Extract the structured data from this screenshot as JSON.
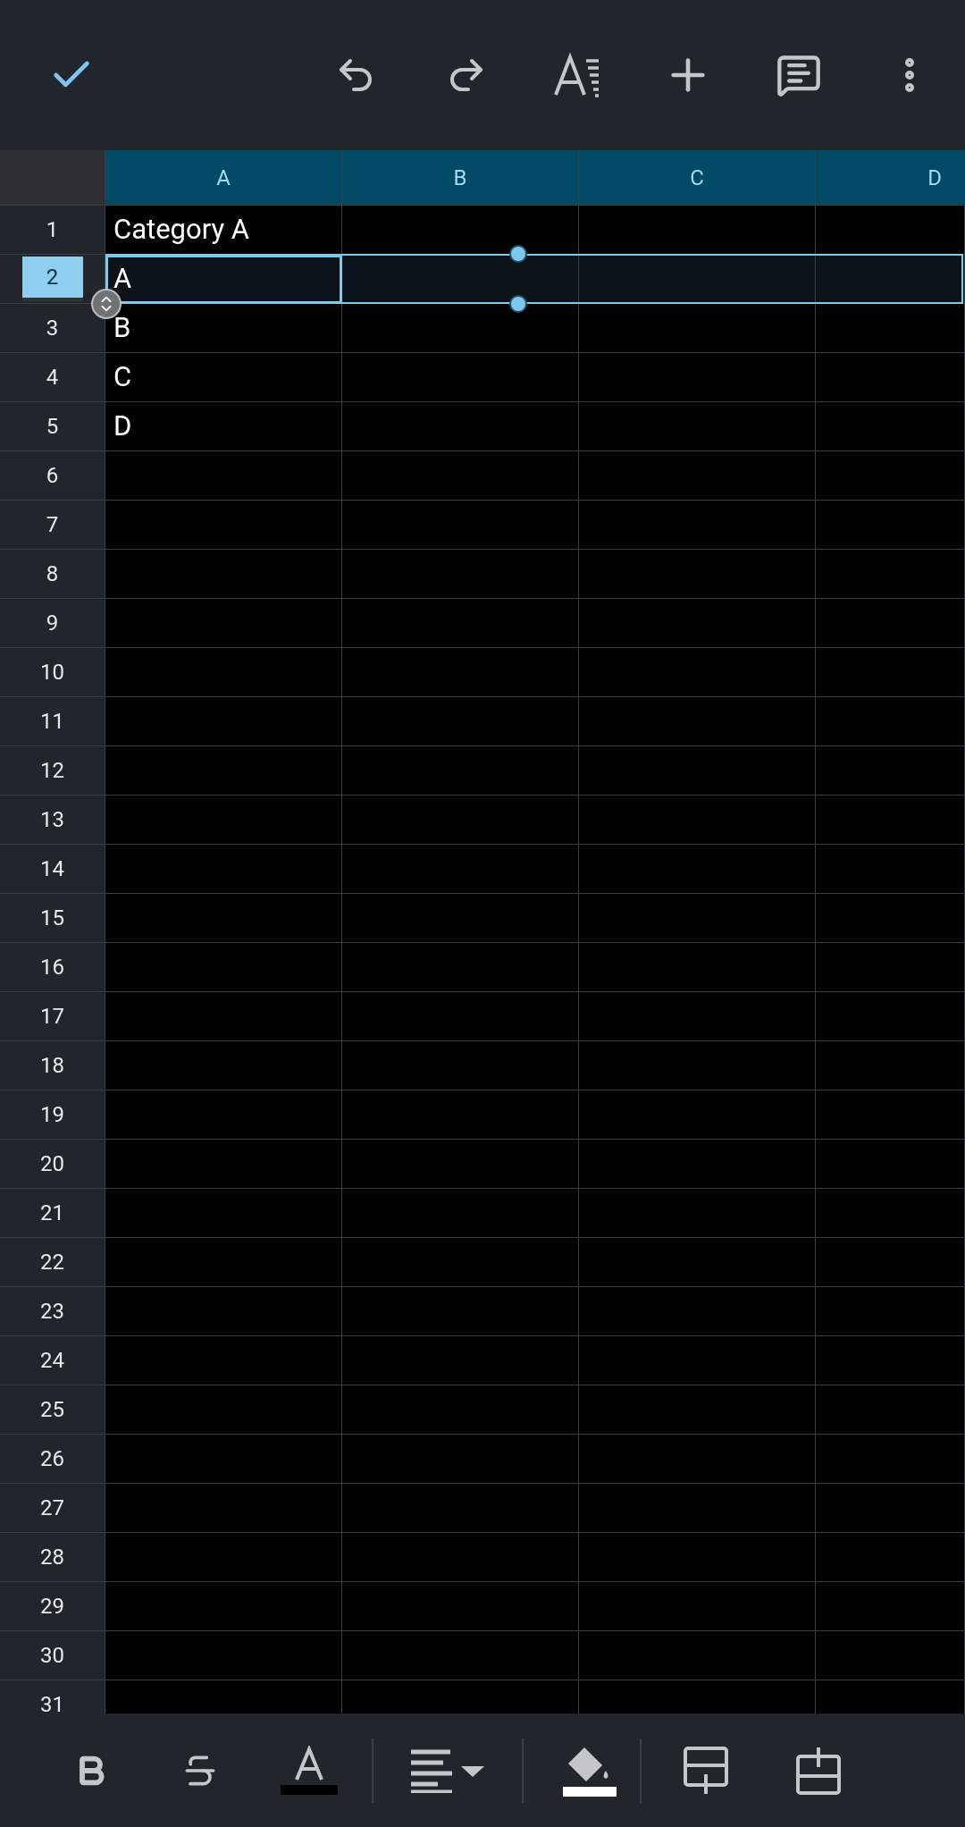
{
  "columns": [
    "A",
    "B",
    "C",
    "D"
  ],
  "rows": [
    {
      "number": "1",
      "selected": false,
      "text": "Category A"
    },
    {
      "number": "2",
      "selected": true,
      "text": "A"
    },
    {
      "number": "3",
      "selected": false,
      "text": "B"
    },
    {
      "number": "4",
      "selected": false,
      "text": "C"
    },
    {
      "number": "5",
      "selected": false,
      "text": "D"
    },
    {
      "number": "6",
      "selected": false
    },
    {
      "number": "7",
      "selected": false
    },
    {
      "number": "8",
      "selected": false
    },
    {
      "number": "9",
      "selected": false
    },
    {
      "number": "10",
      "selected": false
    },
    {
      "number": "11",
      "selected": false
    },
    {
      "number": "12",
      "selected": false
    },
    {
      "number": "13",
      "selected": false
    },
    {
      "number": "14",
      "selected": false
    },
    {
      "number": "15",
      "selected": false
    },
    {
      "number": "16",
      "selected": false
    },
    {
      "number": "17",
      "selected": false
    },
    {
      "number": "18",
      "selected": false
    },
    {
      "number": "19",
      "selected": false
    },
    {
      "number": "20",
      "selected": false
    },
    {
      "number": "21",
      "selected": false
    },
    {
      "number": "22",
      "selected": false
    },
    {
      "number": "23",
      "selected": false
    },
    {
      "number": "24",
      "selected": false
    },
    {
      "number": "25",
      "selected": false
    },
    {
      "number": "26",
      "selected": false
    },
    {
      "number": "27",
      "selected": false
    },
    {
      "number": "28",
      "selected": false
    },
    {
      "number": "29",
      "selected": false
    },
    {
      "number": "30",
      "selected": false
    },
    {
      "number": "31",
      "selected": false
    }
  ]
}
